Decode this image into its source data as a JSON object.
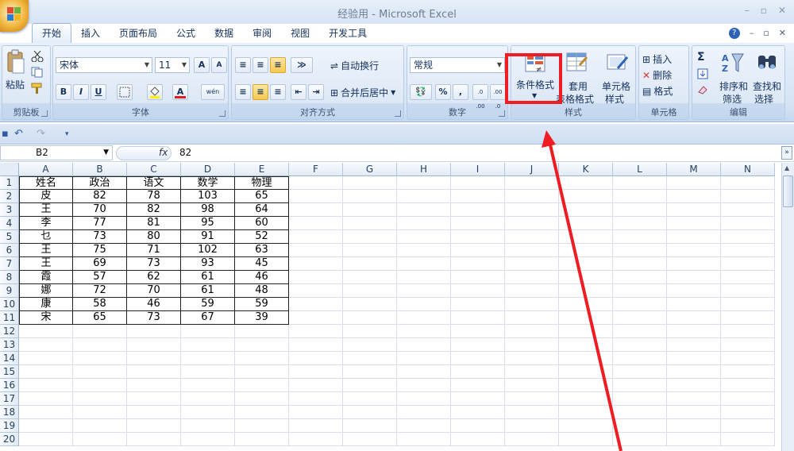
{
  "window": {
    "title": "经验用 - Microsoft Excel",
    "minimize": "–",
    "restore": "▫",
    "close": "✕"
  },
  "tabs": [
    "开始",
    "插入",
    "页面布局",
    "公式",
    "数据",
    "审阅",
    "视图",
    "开发工具"
  ],
  "active_tab": "开始",
  "tab_right": {
    "help": "?",
    "min": "–",
    "restore": "▫",
    "close": "✕"
  },
  "ribbon": {
    "clipboard": {
      "label": "剪贴板",
      "paste": "粘贴"
    },
    "font": {
      "label": "字体",
      "font_name": "宋体",
      "font_size": "11",
      "grow": "A",
      "shrink": "A",
      "bold": "B",
      "italic": "I",
      "underline": "U",
      "phonetic": "wén"
    },
    "alignment": {
      "label": "对齐方式",
      "wrap_text": "自动换行",
      "merge_center": "合并后居中"
    },
    "number": {
      "label": "数字",
      "format": "常规",
      "percent": "%",
      "comma": ",",
      "inc_dec": ".0 .00",
      "dec_dec": ".00 .0"
    },
    "styles": {
      "label": "样式",
      "conditional": "条件格式",
      "table_format_1": "套用",
      "table_format_2": "表格格式",
      "cell_styles_1": "单元格",
      "cell_styles_2": "样式"
    },
    "cells": {
      "label": "单元格",
      "insert": "插入",
      "delete": "删除",
      "format": "格式"
    },
    "editing": {
      "label": "编辑",
      "sigma": "Σ",
      "sort_1": "排序和",
      "sort_2": "筛选",
      "find_1": "查找和",
      "find_2": "选择"
    }
  },
  "formula_bar": {
    "name_box": "B2",
    "fx": "fx",
    "value": "82"
  },
  "columns": [
    "A",
    "B",
    "C",
    "D",
    "E",
    "F",
    "G",
    "H",
    "I",
    "J",
    "K",
    "L",
    "M",
    "N"
  ],
  "rows": [
    "1",
    "2",
    "3",
    "4",
    "5",
    "6",
    "7",
    "8",
    "9",
    "10",
    "11",
    "12",
    "13",
    "14",
    "15",
    "16",
    "17",
    "18",
    "19",
    "20"
  ],
  "table": [
    [
      "姓名",
      "政治",
      "语文",
      "数学",
      "物理"
    ],
    [
      "皮",
      "82",
      "78",
      "103",
      "65"
    ],
    [
      "王",
      "70",
      "82",
      "98",
      "64"
    ],
    [
      "李",
      "77",
      "81",
      "95",
      "60"
    ],
    [
      "乜",
      "73",
      "80",
      "91",
      "52"
    ],
    [
      "王",
      "75",
      "71",
      "102",
      "63"
    ],
    [
      "王",
      "69",
      "73",
      "93",
      "45"
    ],
    [
      "霞",
      "57",
      "62",
      "61",
      "46"
    ],
    [
      "娜",
      "72",
      "70",
      "61",
      "48"
    ],
    [
      "康",
      "58",
      "46",
      "59",
      "59"
    ],
    [
      "宋",
      "65",
      "73",
      "67",
      "39"
    ]
  ],
  "colors": {
    "highlight": "#ef1d23",
    "ribbon": "#dde8f6"
  }
}
